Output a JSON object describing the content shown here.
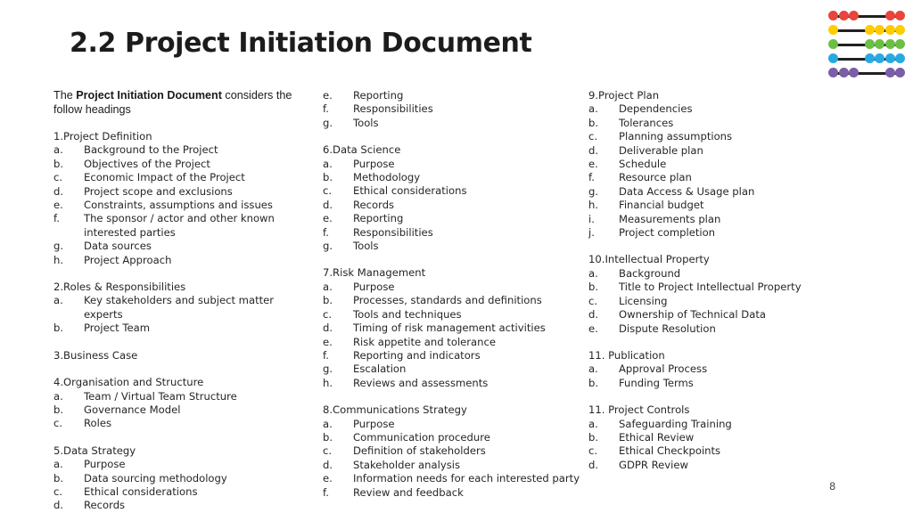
{
  "slide": {
    "title": "2.2 Project Initiation Document",
    "page_number": "8"
  },
  "intro": {
    "before": "The ",
    "bold": "Project Initiation Document",
    "after": " considers the follow headings"
  },
  "logo": {
    "name": "abacus-logo",
    "rows": [
      {
        "color": "#E8453C",
        "left_beads": 3,
        "right_beads": 2
      },
      {
        "color": "#FFCC00",
        "left_beads": 1,
        "right_beads": 4
      },
      {
        "color": "#6CBE45",
        "left_beads": 1,
        "right_beads": 4
      },
      {
        "color": "#27AAE1",
        "left_beads": 1,
        "right_beads": 4
      },
      {
        "color": "#7B5EA7",
        "left_beads": 3,
        "right_beads": 2
      }
    ],
    "rod_color": "#231F20"
  },
  "columns": [
    {
      "id": "left",
      "sections": [
        {
          "heading": "1.Project Definition",
          "items": [
            {
              "marker": "a.",
              "text": "Background to the Project"
            },
            {
              "marker": "b.",
              "text": "Objectives of the Project"
            },
            {
              "marker": "c.",
              "text": "Economic Impact of the Project"
            },
            {
              "marker": "d.",
              "text": "Project scope and exclusions"
            },
            {
              "marker": "e.",
              "text": "Constraints, assumptions and issues"
            },
            {
              "marker": "f.",
              "text": "The sponsor / actor and other known interested parties"
            },
            {
              "marker": "g.",
              "text": "Data sources"
            },
            {
              "marker": "h.",
              "text": "Project Approach"
            }
          ]
        },
        {
          "heading": "2.Roles & Responsibilities",
          "items": [
            {
              "marker": "a.",
              "text": "Key stakeholders and subject matter experts"
            },
            {
              "marker": "b.",
              "text": "Project Team"
            }
          ]
        },
        {
          "heading": "3.Business Case",
          "items": []
        },
        {
          "heading": "4.Organisation and Structure",
          "items": [
            {
              "marker": "a.",
              "text": "Team / Virtual Team Structure"
            },
            {
              "marker": "b.",
              "text": "Governance Model"
            },
            {
              "marker": "c.",
              "text": "Roles"
            }
          ]
        },
        {
          "heading": "5.Data Strategy",
          "items": [
            {
              "marker": "a.",
              "text": "Purpose"
            },
            {
              "marker": "b.",
              "text": "Data sourcing methodology"
            },
            {
              "marker": "c.",
              "text": "Ethical considerations"
            },
            {
              "marker": "d.",
              "text": "Records"
            }
          ]
        }
      ]
    },
    {
      "id": "mid",
      "sections": [
        {
          "heading": "",
          "items": [
            {
              "marker": "e.",
              "text": "Reporting"
            },
            {
              "marker": "f.",
              "text": "Responsibilities"
            },
            {
              "marker": "g.",
              "text": "Tools"
            }
          ]
        },
        {
          "heading": "6.Data Science",
          "items": [
            {
              "marker": "a.",
              "text": "Purpose"
            },
            {
              "marker": "b.",
              "text": "Methodology"
            },
            {
              "marker": "c.",
              "text": "Ethical considerations"
            },
            {
              "marker": "d.",
              "text": "Records"
            },
            {
              "marker": "e.",
              "text": "Reporting"
            },
            {
              "marker": "f.",
              "text": "Responsibilities"
            },
            {
              "marker": "g.",
              "text": "Tools"
            }
          ]
        },
        {
          "heading": "7.Risk Management",
          "items": [
            {
              "marker": "a.",
              "text": "Purpose"
            },
            {
              "marker": "b.",
              "text": "Processes, standards and definitions"
            },
            {
              "marker": "c.",
              "text": "Tools and techniques"
            },
            {
              "marker": "d.",
              "text": "Timing of risk management activities"
            },
            {
              "marker": "e.",
              "text": "Risk appetite and tolerance"
            },
            {
              "marker": "f.",
              "text": "Reporting and indicators"
            },
            {
              "marker": "g.",
              "text": "Escalation"
            },
            {
              "marker": "h.",
              "text": "Reviews and assessments"
            }
          ]
        },
        {
          "heading": "8.Communications Strategy",
          "items": [
            {
              "marker": "a.",
              "text": "Purpose"
            },
            {
              "marker": "b.",
              "text": "Communication procedure"
            },
            {
              "marker": "c.",
              "text": "Definition of stakeholders"
            },
            {
              "marker": "d.",
              "text": "Stakeholder analysis"
            },
            {
              "marker": "e.",
              "text": "Information needs for each interested party"
            },
            {
              "marker": "f.",
              "text": "Review and feedback"
            }
          ]
        }
      ]
    },
    {
      "id": "right",
      "sections": [
        {
          "heading": "9.Project Plan",
          "items": [
            {
              "marker": "a.",
              "text": "Dependencies"
            },
            {
              "marker": "b.",
              "text": "Tolerances"
            },
            {
              "marker": "c.",
              "text": "Planning assumptions"
            },
            {
              "marker": "d.",
              "text": "Deliverable plan"
            },
            {
              "marker": "e.",
              "text": "Schedule"
            },
            {
              "marker": "f.",
              "text": "Resource plan"
            },
            {
              "marker": "g.",
              "text": "Data Access & Usage plan"
            },
            {
              "marker": "h.",
              "text": "Financial budget"
            },
            {
              "marker": "i.",
              "text": "Measurements plan"
            },
            {
              "marker": "j.",
              "text": "Project completion"
            }
          ]
        },
        {
          "heading": "10.Intellectual Property",
          "items": [
            {
              "marker": "a.",
              "text": "Background"
            },
            {
              "marker": "b.",
              "text": "Title to Project Intellectual Property"
            },
            {
              "marker": "c.",
              "text": "Licensing"
            },
            {
              "marker": "d.",
              "text": "Ownership of Technical Data"
            },
            {
              "marker": "e.",
              "text": "Dispute Resolution"
            }
          ]
        },
        {
          "heading": "11. Publication",
          "items": [
            {
              "marker": "a.",
              "text": "Approval Process"
            },
            {
              "marker": "b.",
              "text": "Funding Terms"
            }
          ]
        },
        {
          "heading": "11. Project Controls",
          "items": [
            {
              "marker": "a.",
              "text": "Safeguarding Training"
            },
            {
              "marker": "b.",
              "text": "Ethical Review"
            },
            {
              "marker": "c.",
              "text": "Ethical Checkpoints"
            },
            {
              "marker": "d.",
              "text": "GDPR Review"
            }
          ]
        }
      ]
    }
  ]
}
